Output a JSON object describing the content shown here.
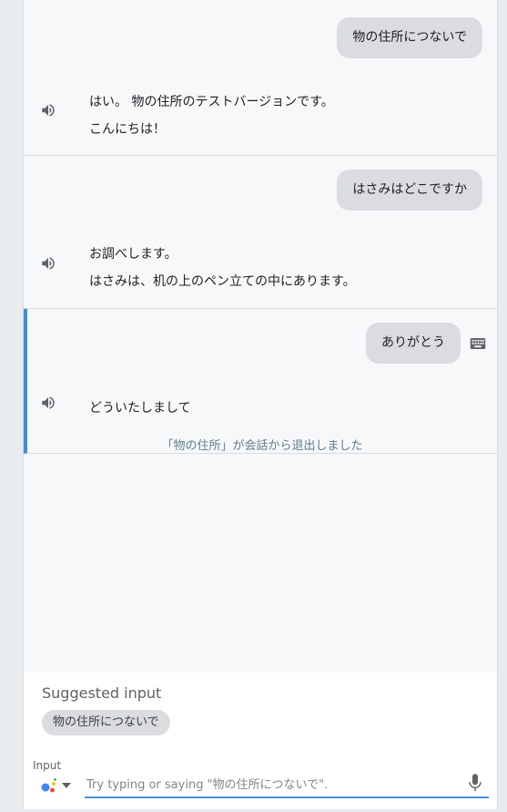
{
  "conversation": {
    "turns": [
      {
        "user": "物の住所につないで",
        "agent_lines": [
          "はい。 物の住所のテストバージョンです。",
          "こんにちは！"
        ]
      },
      {
        "user": "はさみはどこですか",
        "agent_lines": [
          "お調べします。",
          "はさみは、机の上のペン立ての中にあります。"
        ]
      },
      {
        "user": "ありがとう",
        "agent_lines": [
          "どういたしまして"
        ],
        "exit_note": "「物の住所」が会話から退出しました"
      }
    ]
  },
  "suggestions": {
    "title": "Suggested input",
    "chips": [
      "物の住所につないで"
    ]
  },
  "input": {
    "label": "Input",
    "placeholder": "Try typing or saying \"物の住所につないで\"."
  },
  "icons": {
    "speaker": "volume-icon",
    "keyboard": "keyboard-icon",
    "mic": "mic-icon",
    "assistant": "google-assistant-icon"
  },
  "colors": {
    "accent": "#3f8fd8",
    "bubble": "#dadce0",
    "background": "#f7f8fa"
  }
}
